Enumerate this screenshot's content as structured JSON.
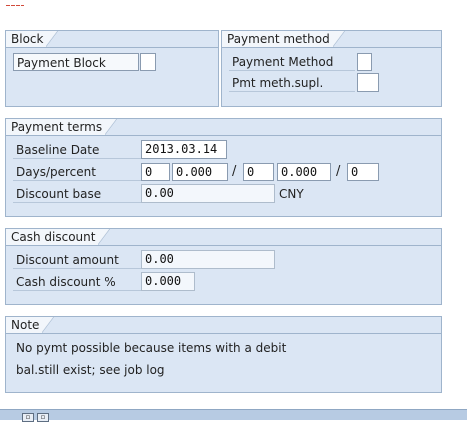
{
  "block": {
    "title": "Block",
    "payment_block_label": "Payment Block",
    "payment_block_value": ""
  },
  "payment_method": {
    "title": "Payment method",
    "method_label": "Payment Method",
    "method_value": "",
    "supl_label": "Pmt meth.supl.",
    "supl_value": ""
  },
  "payment_terms": {
    "title": "Payment terms",
    "baseline_label": "Baseline Date",
    "baseline_value": "2013.03.14",
    "days_label": "Days/percent",
    "days1": "0",
    "pct1": "0.000",
    "slash": "/",
    "days2": "0",
    "pct2": "0.000",
    "days3": "0",
    "discount_base_label": "Discount base",
    "discount_base_value": "0.00",
    "currency": "CNY"
  },
  "cash_discount": {
    "title": "Cash discount",
    "amount_label": "Discount amount",
    "amount_value": "0.00",
    "pct_label": "Cash discount %",
    "pct_value": "0.000"
  },
  "note": {
    "title": "Note",
    "line1": "No pymt possible because items with a debit",
    "line2": "bal.still exist; see job log"
  },
  "colors": {
    "group_bg": "#dbe6f4",
    "group_border": "#9fb4cc",
    "accent_red": "#d24a3a"
  }
}
